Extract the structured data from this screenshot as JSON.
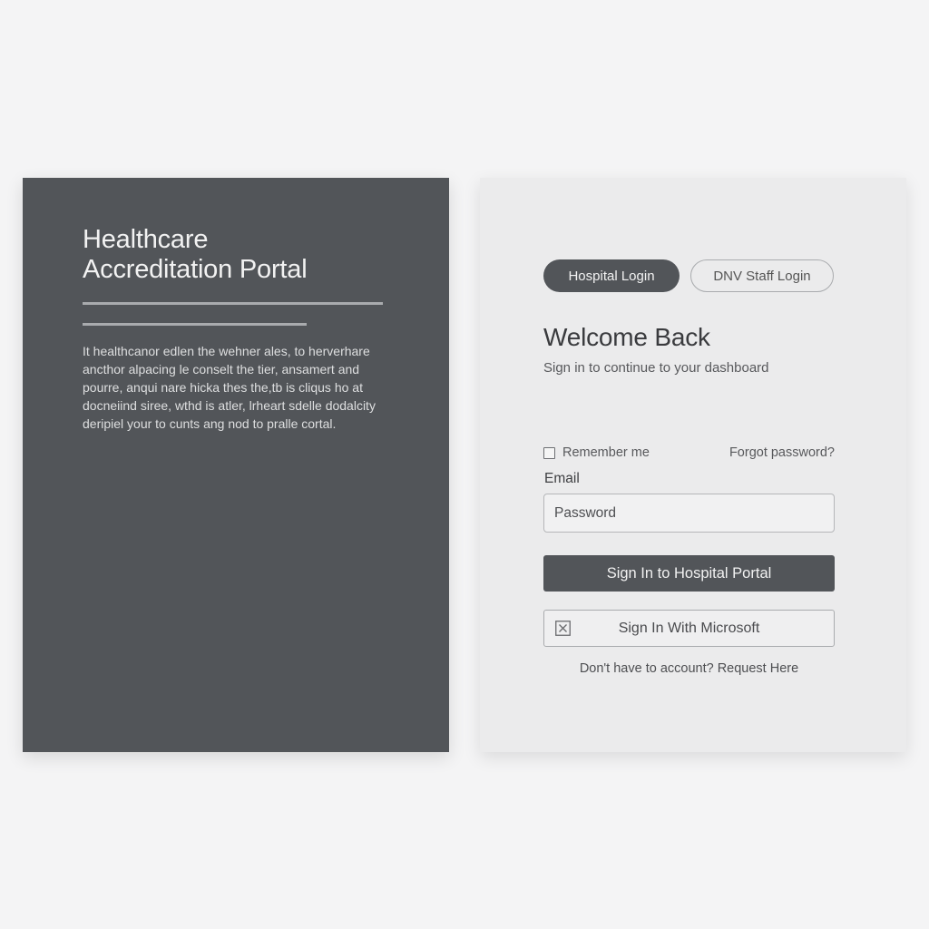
{
  "brand": {
    "title_line1": "Healthcare",
    "title_line2": "Accreditation Portal",
    "description_lines": [
      "It healthcanor edlen the wehner ales, to herverhare",
      "ancthor alpacing le conselt the tier, ansamert and",
      "pourre, anqui nare hicka thes the,tb is cliqus ho at",
      "docneiind siree, wthd is atler, lrheart sdelle dodalcity",
      "deripiel your to cunts ang nod to pralle cortal."
    ]
  },
  "login": {
    "tabs": {
      "hospital": "Hospital Login",
      "dnv": "DNV Staff Login"
    },
    "heading": "Welcome Back",
    "subtitle": "Sign in to continue to your dashboard",
    "remember_label": "Remember me",
    "forgot_label": "Forgot password?",
    "email_label": "Email",
    "password_placeholder": "Password",
    "signin_label": "Sign In to Hospital Portal",
    "microsoft_label": "Sign In With Microsoft",
    "microsoft_icon": "microsoft-box-icon",
    "request_text": "Don't have to account? Request Here"
  },
  "colors": {
    "dark_panel": "#525559",
    "light_panel": "#ebebec",
    "page_background": "#f4f4f5"
  }
}
